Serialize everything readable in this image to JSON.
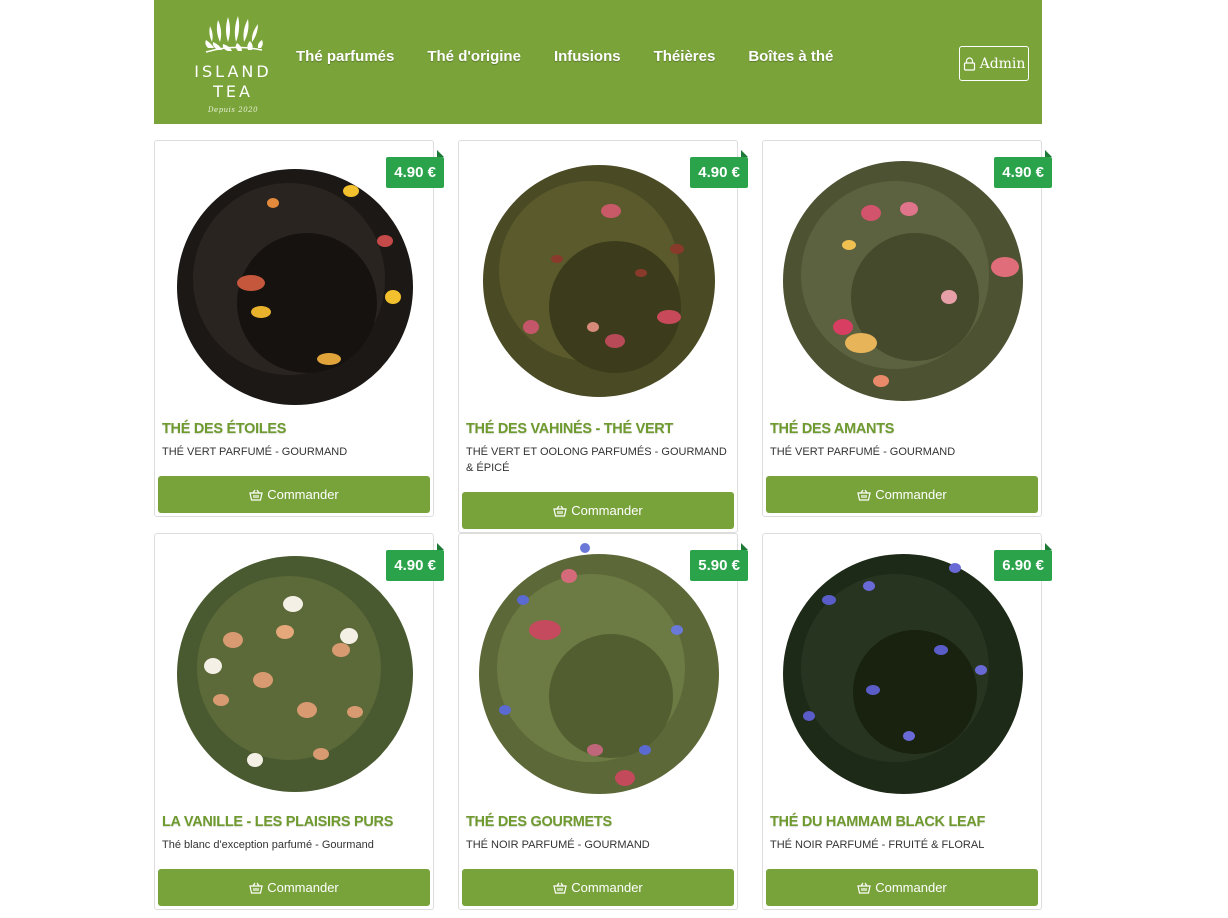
{
  "header": {
    "logo": {
      "line1": "ISLAND",
      "line2": "TEA",
      "line3": "Depuis 2020"
    },
    "nav": [
      "Thé parfumés",
      "Thé d'origine",
      "Infusions",
      "Théières",
      "Boîtes à thé"
    ],
    "admin_label": "Admin"
  },
  "colors": {
    "header": "#7aa33a",
    "button": "#78a23a",
    "price": "#2aa34b",
    "title": "#6e9a2e"
  },
  "products": [
    {
      "name": "THÉ DES ÉTOILES",
      "subtitle": "THÉ VERT PARFUMÉ - GOURMAND",
      "price": "4.90 €",
      "button": "Commander",
      "image": "black-tea-leaves-with-flower-petals"
    },
    {
      "name": "THÉ DES VAHINÉS - THÉ VERT",
      "subtitle": "THÉ VERT ET OOLONG PARFUMÉS - GOURMAND & ÉPICÉ",
      "price": "4.90 €",
      "button": "Commander",
      "image": "green-oolong-tea-with-petals"
    },
    {
      "name": "THÉ DES AMANTS",
      "subtitle": "THÉ VERT PARFUMÉ - GOURMAND",
      "price": "4.90 €",
      "button": "Commander",
      "image": "green-tea-with-rose-petals"
    },
    {
      "name": "LA VANILLE - LES PLAISIRS PURS",
      "subtitle": "Thé blanc d'exception parfumé - Gourmand",
      "price": "4.90 €",
      "button": "Commander",
      "image": "tea-with-rice-and-popcorn"
    },
    {
      "name": "THÉ DES GOURMETS",
      "subtitle": "THÉ NOIR PARFUMÉ - GOURMAND",
      "price": "5.90 €",
      "button": "Commander",
      "image": "green-tea-with-cornflowers"
    },
    {
      "name": "THÉ DU HAMMAM BLACK LEAF",
      "subtitle": "THÉ NOIR PARFUMÉ - FRUITÉ & FLORAL",
      "price": "6.90 €",
      "button": "Commander",
      "image": "dark-tea-with-blue-petals"
    }
  ]
}
